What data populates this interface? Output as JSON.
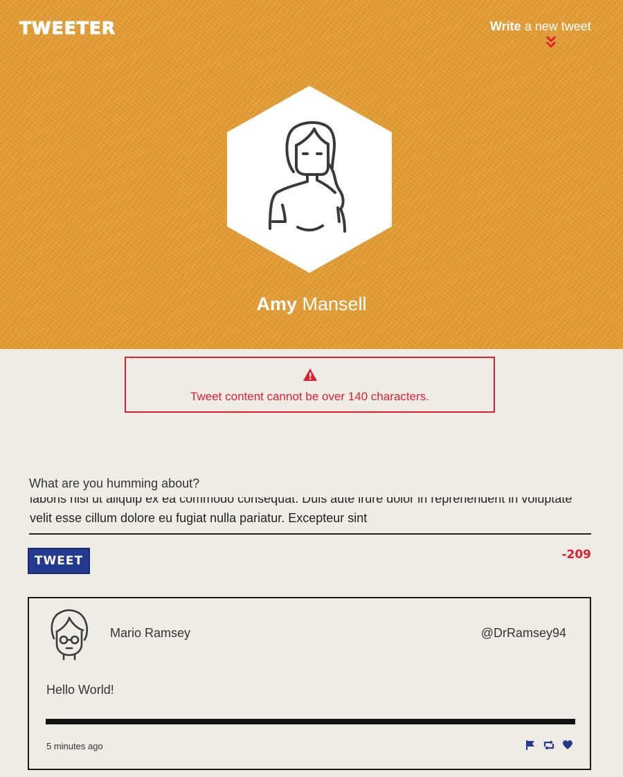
{
  "header": {
    "logo": "TWEETER",
    "write_bold": "Write",
    "write_rest": " a new tweet"
  },
  "profile": {
    "first_name": "Amy",
    "last_name": "Mansell"
  },
  "error": {
    "message": "Tweet content cannot be over 140 characters."
  },
  "composer": {
    "label": "What are you humming about?",
    "text": "laboris nisi ut aliquip ex ea commodo consequat. Duis aute irure dolor in reprehenderit in voluptate velit esse cillum dolore eu fugiat nulla pariatur. Excepteur sint",
    "button_label": "TWEET",
    "counter": "-209"
  },
  "tweets": [
    {
      "author": "Mario Ramsey",
      "handle": "@DrRamsey94",
      "content": "Hello World!",
      "time": "5 minutes ago"
    }
  ],
  "colors": {
    "hero_bg": "#e49d33",
    "error": "#e0202e",
    "button_bg": "#243a8f",
    "action_icons": "#243a8f"
  }
}
